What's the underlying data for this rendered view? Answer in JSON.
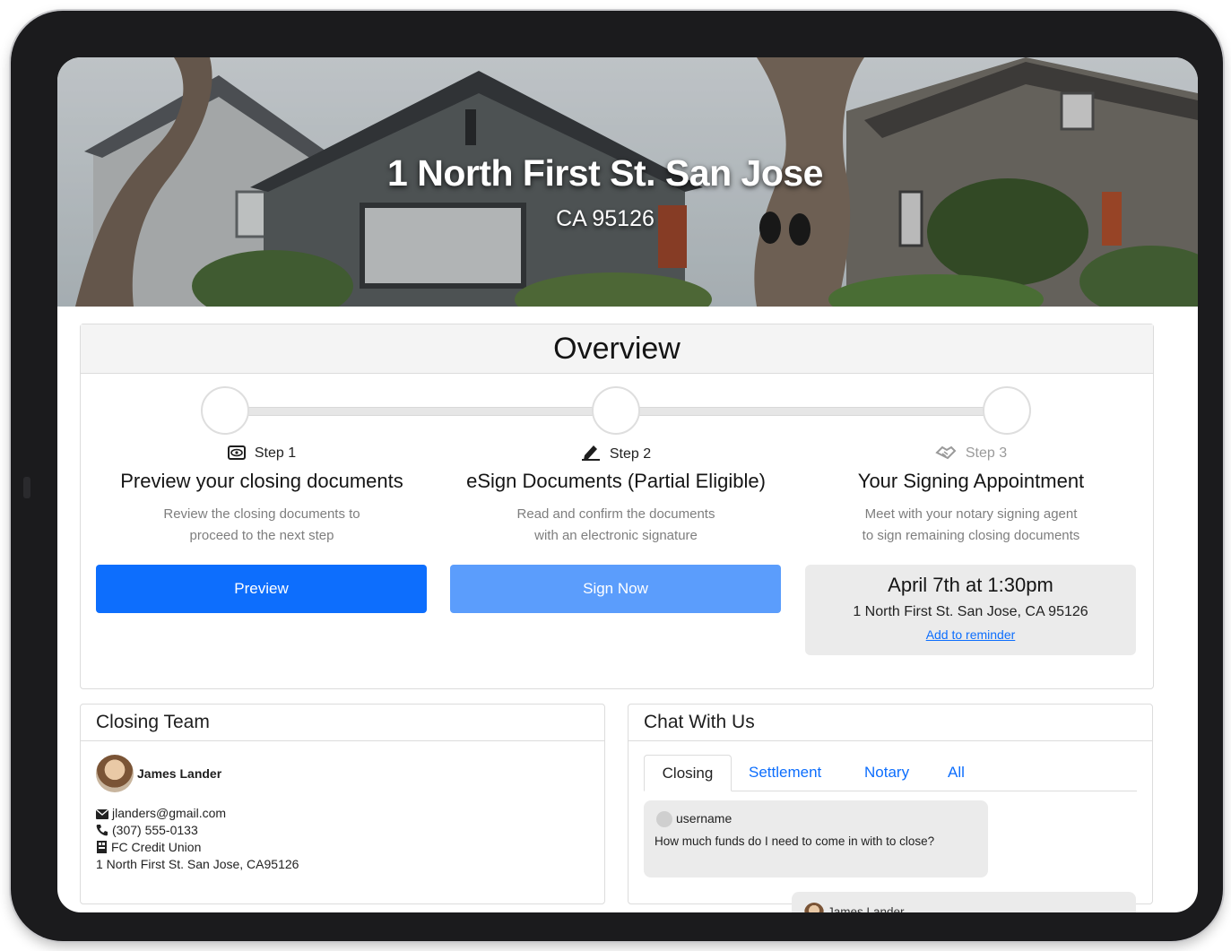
{
  "hero": {
    "title": "1 North First St. San Jose",
    "subtitle": "CA 95126"
  },
  "overview": {
    "heading": "Overview",
    "steps": [
      {
        "label": "Step 1",
        "icon": "eye-icon",
        "title": "Preview your closing documents",
        "description_line1": "Review the closing documents to",
        "description_line2": "proceed to the next step",
        "button_label": "Preview"
      },
      {
        "label": "Step 2",
        "icon": "pen-icon",
        "title": "eSign Documents (Partial Eligible)",
        "description_line1": "Read and confirm the documents",
        "description_line2": "with an electronic signature",
        "button_label": "Sign Now"
      },
      {
        "label": "Step 3",
        "icon": "handshake-icon",
        "title": "Your Signing Appointment",
        "description_line1": "Meet with your notary signing agent",
        "description_line2": "to sign remaining closing documents"
      }
    ],
    "appointment": {
      "time": "April 7th at 1:30pm",
      "address": "1 North First St. San Jose, CA 95126",
      "reminder_link": "Add to reminder"
    }
  },
  "closing_team": {
    "title": "Closing Team",
    "member": {
      "name": "James Lander",
      "email": "jlanders@gmail.com",
      "phone": "(307) 555-0133",
      "company": "FC Credit Union",
      "address": "1 North First St. San Jose, CA95126"
    }
  },
  "chat": {
    "title": "Chat With Us",
    "tabs": [
      "Closing",
      "Settlement",
      "Notary",
      "All"
    ],
    "active_tab": "Closing",
    "messages": [
      {
        "user": "username",
        "text": "How much funds do I need to come in with to close?"
      },
      {
        "user": "James Lander",
        "text": ""
      }
    ]
  },
  "colors": {
    "primary": "#0d6efd",
    "primary_light": "#5b9dfc",
    "panel_gray": "#ebebeb"
  }
}
